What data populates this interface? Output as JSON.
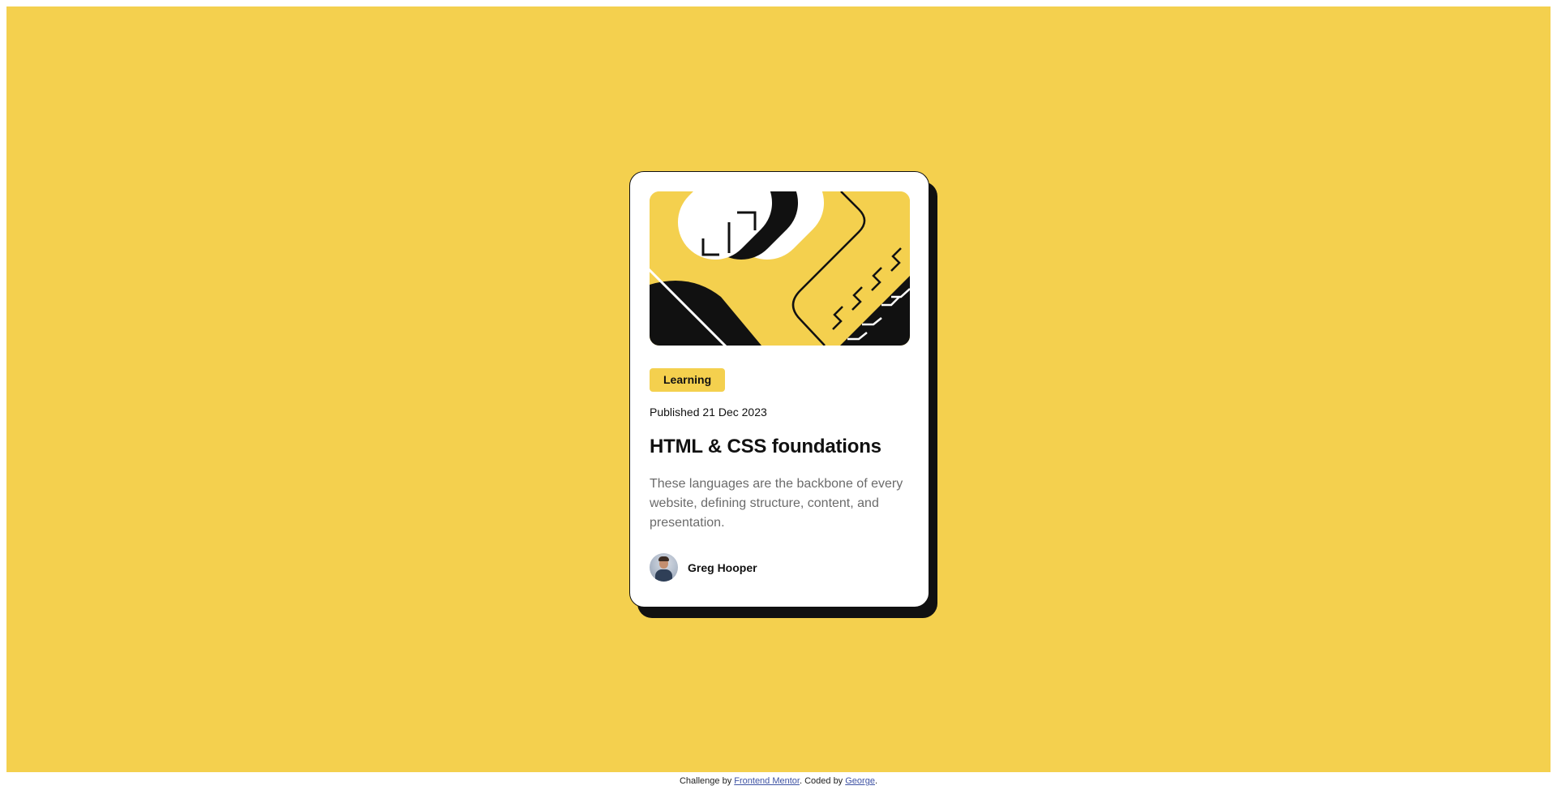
{
  "card": {
    "tag": "Learning",
    "published": "Published 21 Dec 2023",
    "title": "HTML & CSS foundations",
    "description": "These languages are the backbone of every website, defining structure, content, and presentation.",
    "author_name": "Greg Hooper"
  },
  "footer": {
    "prefix": "Challenge by ",
    "link1": "Frontend Mentor",
    "middle": ". Coded by ",
    "link2": "George",
    "suffix": "."
  },
  "colors": {
    "background": "#f4d04e",
    "card": "#ffffff",
    "ink": "#111111",
    "muted_text": "#6b6b6b",
    "link": "#3e52a3"
  },
  "icons": {
    "hero": "abstract-illustration-icon",
    "avatar": "author-avatar-icon"
  }
}
